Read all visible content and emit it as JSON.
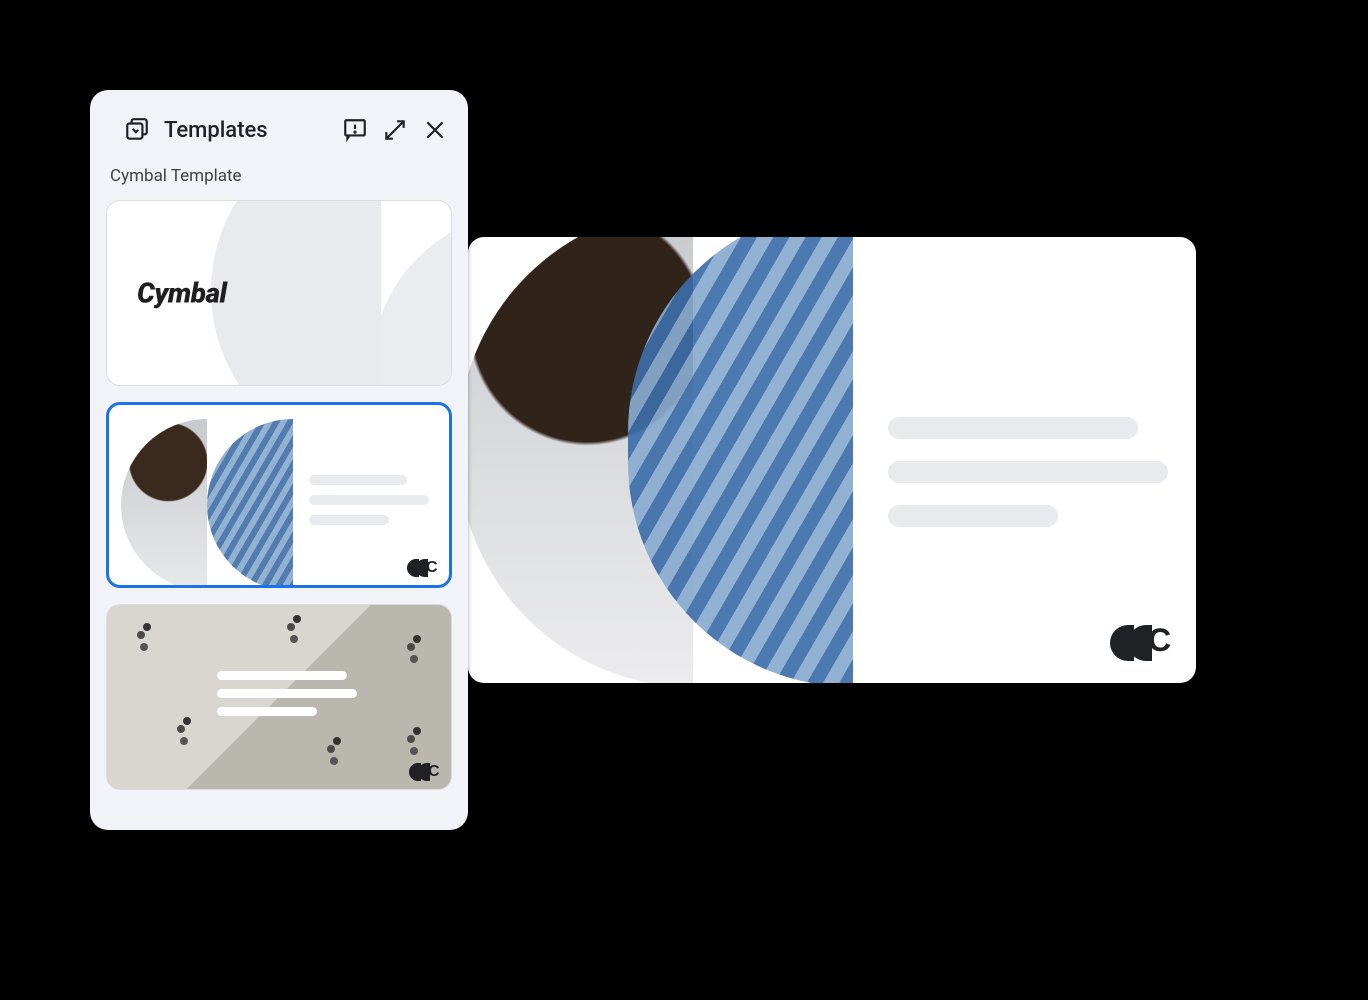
{
  "panel": {
    "title": "Templates",
    "subtitle": "Cymbal Template",
    "icons": {
      "templates": "templates-icon",
      "feedback": "feedback-icon",
      "expand": "expand-icon",
      "close": "close-icon"
    },
    "cards": [
      {
        "id": "card1",
        "label": "Cymbal",
        "selected": false,
        "kind": "title-slide"
      },
      {
        "id": "card2",
        "label": "",
        "selected": true,
        "kind": "photo-text-slide"
      },
      {
        "id": "card3",
        "label": "",
        "selected": false,
        "kind": "aerial-photo-slide"
      }
    ]
  },
  "preview": {
    "brand_mark": "C"
  },
  "colors": {
    "accent": "#1a73e8",
    "panel_bg": "#f1f3f8",
    "text": "#202124",
    "placeholder": "#e8eaed"
  }
}
